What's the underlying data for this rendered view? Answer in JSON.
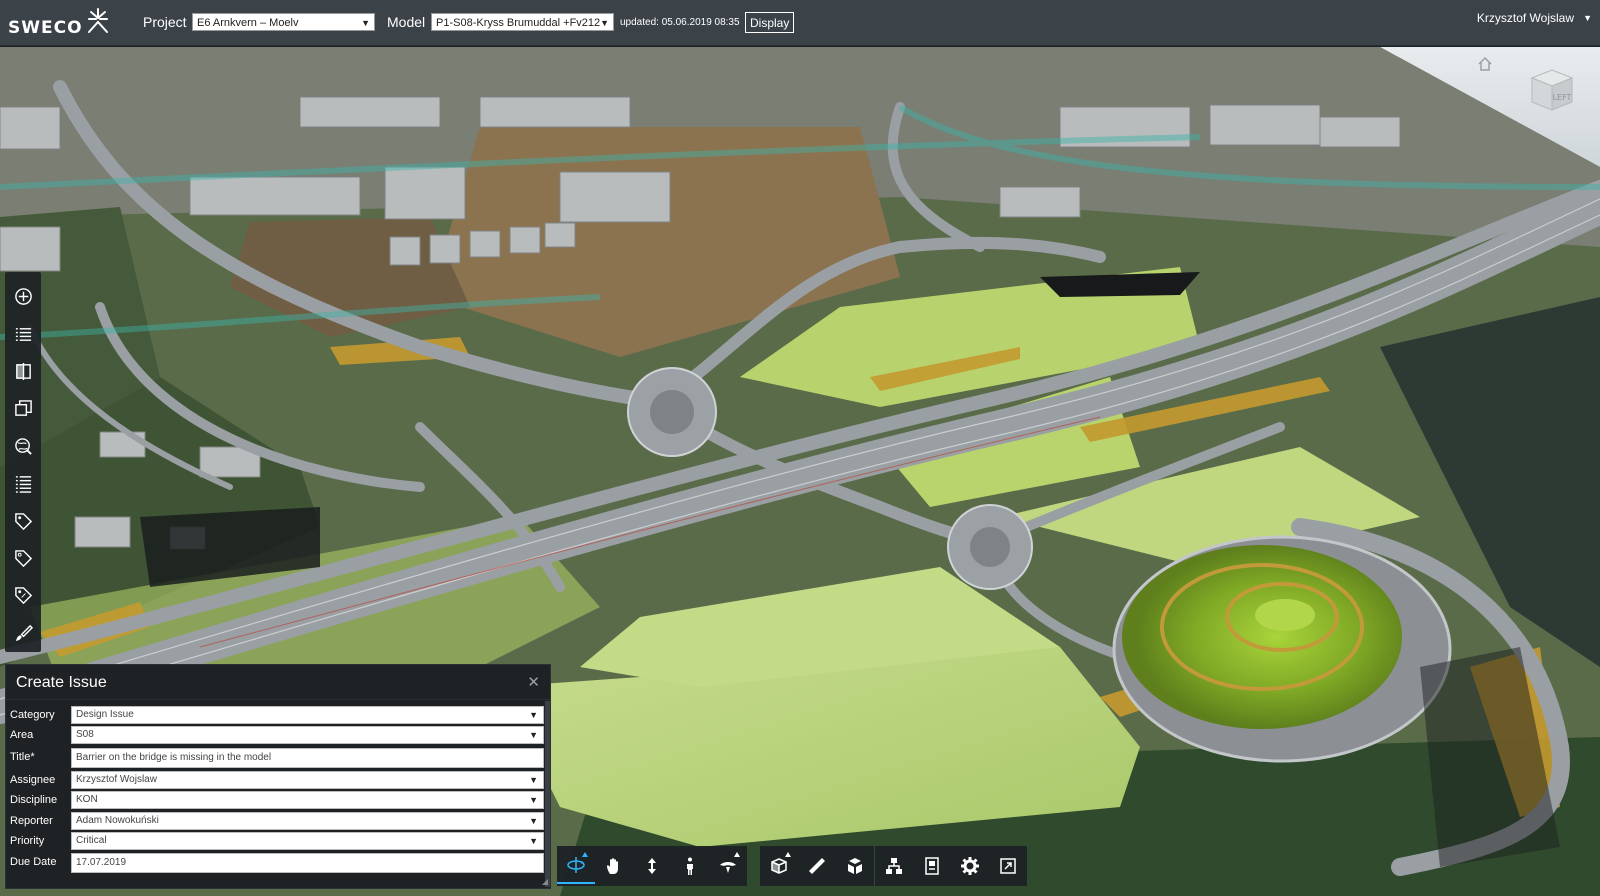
{
  "topbar": {
    "logo_text": "SWECO",
    "project_label": "Project",
    "project_value": "E6 Arnkvern – Moelv",
    "model_label": "Model",
    "model_value": "P1-S08-Kryss Brumuddal +Fv212",
    "updated_text": "updated: 05.06.2019 08:35",
    "display_label": "Display",
    "user_name": "Krzysztof Wojslaw"
  },
  "viewcube": {
    "face_label": "LEFT"
  },
  "left_toolbar": {
    "icons": [
      "add-circle-icon",
      "list-icon",
      "compare-icon",
      "layers-icon",
      "globe-search-icon",
      "outline-list-icon",
      "tag-icon",
      "tag-outline-icon",
      "tag-alt-icon",
      "brush-icon"
    ]
  },
  "issue_panel": {
    "title": "Create Issue",
    "fields": [
      {
        "label": "Category",
        "value": "Design Issue",
        "type": "select"
      },
      {
        "label": "Area",
        "value": "S08",
        "type": "select"
      },
      {
        "label": "Title*",
        "value": "Barrier on the bridge is missing in the model",
        "type": "text"
      },
      {
        "label": "Assignee",
        "value": "Krzysztof Wojslaw",
        "type": "select"
      },
      {
        "label": "Discipline",
        "value": "KON",
        "type": "select"
      },
      {
        "label": "Reporter",
        "value": "Adam Nowokuński",
        "type": "select"
      },
      {
        "label": "Priority",
        "value": "Critical",
        "type": "select"
      },
      {
        "label": "Due Date",
        "value": "17.07.2019",
        "type": "text"
      }
    ]
  },
  "bottom_toolbar": {
    "group1": [
      "orbit-icon",
      "pan-hand-icon",
      "vertical-move-icon",
      "walk-person-icon",
      "fly-icon"
    ],
    "group2": [
      "section-box-icon",
      "measure-ruler-icon",
      "cube-explode-icon"
    ],
    "group3": [
      "hierarchy-icon",
      "properties-icon",
      "settings-gear-icon",
      "fullscreen-icon"
    ],
    "accent": "#2fb4ff"
  },
  "colors": {
    "topbar": "#3b4248",
    "panel": "#1e2225",
    "grass": "#b5d46a",
    "road": "#8f9499",
    "accent": "#2fb4ff"
  }
}
